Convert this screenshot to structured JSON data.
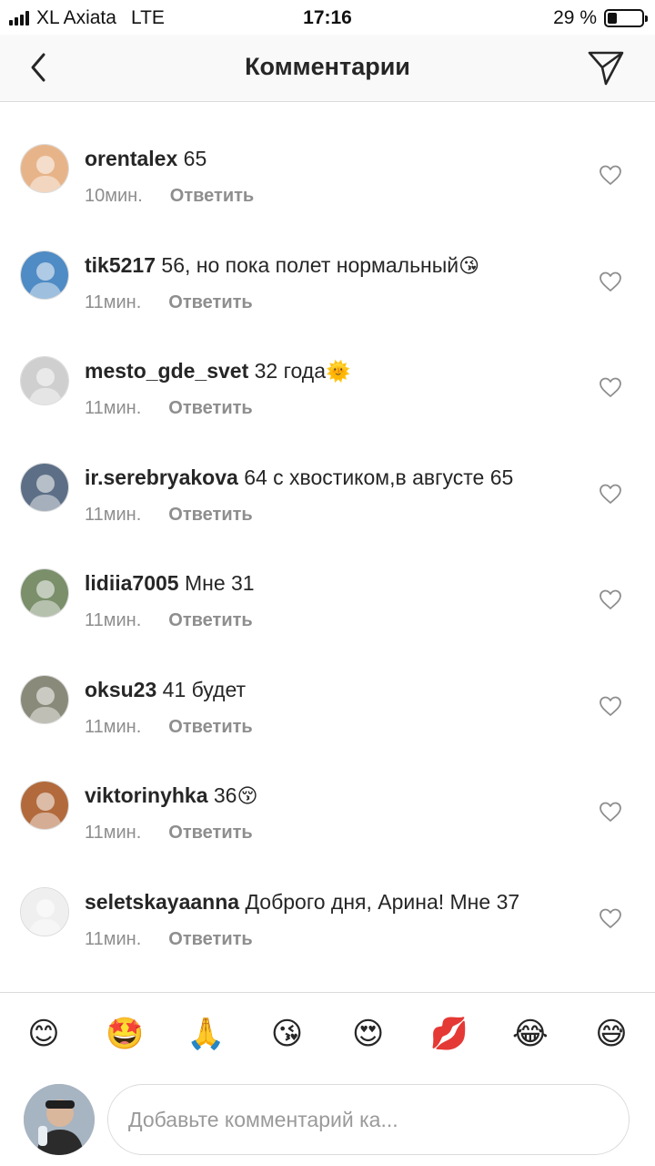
{
  "status": {
    "carrier": "XL Axiata",
    "network": "LTE",
    "time": "17:16",
    "battery_text": "29 %",
    "battery_level": 0.29
  },
  "header": {
    "title": "Комментарии",
    "back_icon": "chevron-left-icon",
    "share_icon": "paper-plane-icon"
  },
  "comments": [
    {
      "username": "orentalex",
      "text": "65",
      "emoji": "",
      "time": "10мин.",
      "reply": "Ответить",
      "avatar_color": "#e7b48a"
    },
    {
      "username": "tik5217",
      "text": "56, но пока полет нормальный",
      "emoji": "😘",
      "time": "11мин.",
      "reply": "Ответить",
      "avatar_color": "#4f8bc4"
    },
    {
      "username": "mesto_gde_svet",
      "text": "32 года",
      "emoji": "🌞",
      "time": "11мин.",
      "reply": "Ответить",
      "avatar_color": "#cfcfcf"
    },
    {
      "username": "ir.serebryakova",
      "text": "64 с хвостиком,в августе 65",
      "emoji": "",
      "time": "11мин.",
      "reply": "Ответить",
      "avatar_color": "#5d6f86"
    },
    {
      "username": "lidiia7005",
      "text": "Мне 31",
      "emoji": "",
      "time": "11мин.",
      "reply": "Ответить",
      "avatar_color": "#7a8f6a"
    },
    {
      "username": "oksu23",
      "text": "41 будет",
      "emoji": "",
      "time": "11мин.",
      "reply": "Ответить",
      "avatar_color": "#8a8a7a"
    },
    {
      "username": "viktorinyhka",
      "text": "36",
      "emoji": "😚",
      "time": "11мин.",
      "reply": "Ответить",
      "avatar_color": "#b26a3c"
    },
    {
      "username": "seletskayaanna",
      "text": "Доброго дня, Арина! Мне 37",
      "emoji": "",
      "time": "11мин.",
      "reply": "Ответить",
      "avatar_color": "#efefef"
    }
  ],
  "emoji_bar": [
    "😊",
    "🤩",
    "🙏",
    "😘",
    "😍",
    "💋",
    "😂",
    "😅"
  ],
  "input": {
    "placeholder": "Добавьте комментарий ка..."
  }
}
